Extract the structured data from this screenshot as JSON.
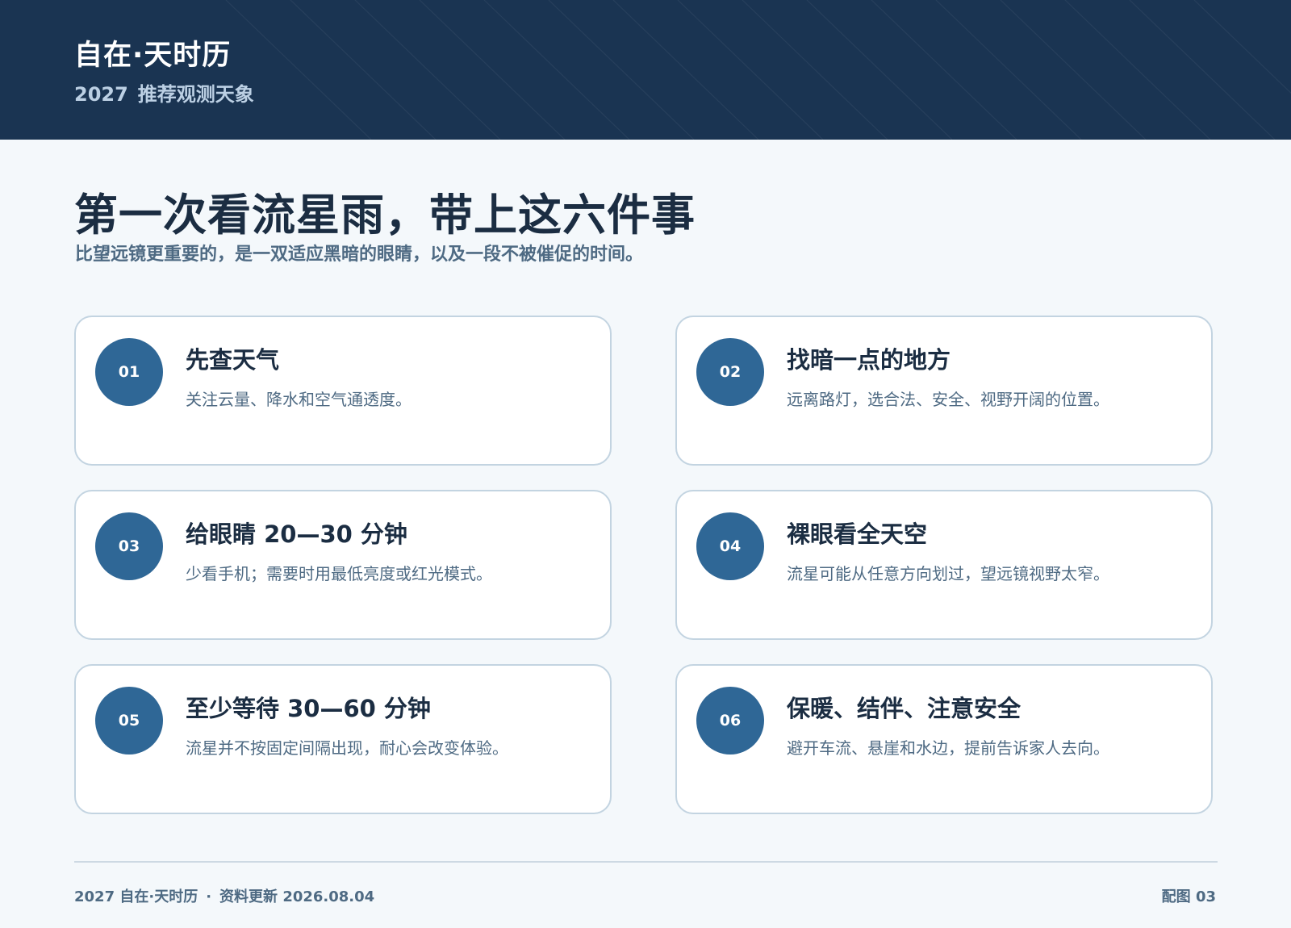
{
  "header": {
    "brand": "自在·天时历",
    "year": "2027",
    "subtitle": "推荐观测天象"
  },
  "page": {
    "title": "第一次看流星雨，带上这六件事",
    "subtitle": "比望远镜更重要的，是一双适应黑暗的眼睛，以及一段不被催促的时间。"
  },
  "cards": [
    {
      "num": "01",
      "title": "先查天气",
      "desc": "关注云量、降水和空气通透度。"
    },
    {
      "num": "02",
      "title": "找暗一点的地方",
      "desc": "远离路灯，选合法、安全、视野开阔的位置。"
    },
    {
      "num": "03",
      "title": "给眼睛 20—30 分钟",
      "desc": "少看手机；需要时用最低亮度或红光模式。"
    },
    {
      "num": "04",
      "title": "裸眼看全天空",
      "desc": "流星可能从任意方向划过，望远镜视野太窄。"
    },
    {
      "num": "05",
      "title": "至少等待 30—60 分钟",
      "desc": "流星并不按固定间隔出现，耐心会改变体验。"
    },
    {
      "num": "06",
      "title": "保暖、结伴、注意安全",
      "desc": "避开车流、悬崖和水边，提前告诉家人去向。"
    }
  ],
  "footer": {
    "left": "2027 自在·天时历",
    "separator": "·",
    "update": "资料更新 2026.08.04",
    "right": "配图 03"
  },
  "colors": {
    "header_bg": "#1a3452",
    "page_bg": "#f4f8fb",
    "accent": "#2f6796",
    "card_border": "#c3d4e1",
    "text_dark": "#1b2d42",
    "text_muted": "#4e6a83"
  }
}
